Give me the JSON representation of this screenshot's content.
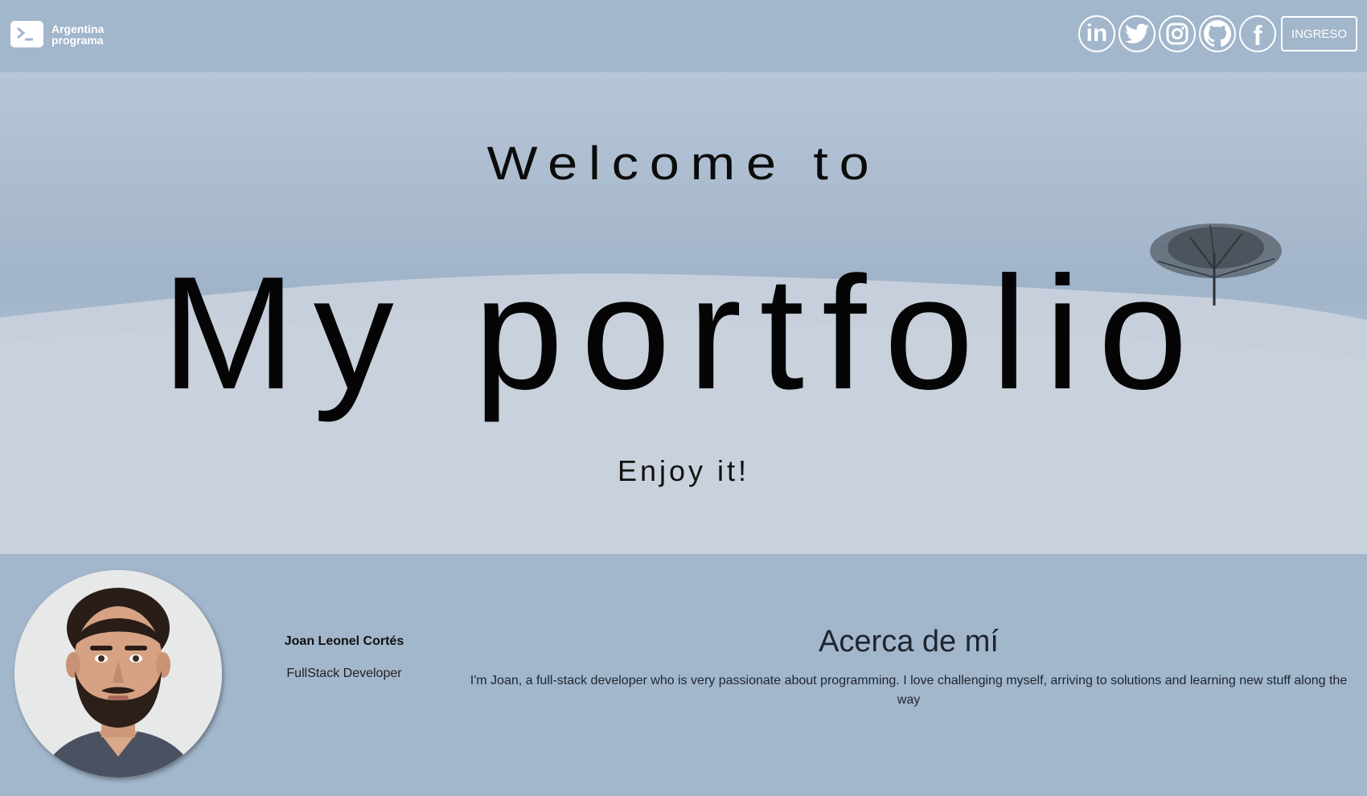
{
  "navbar": {
    "brand": {
      "line1": "Argentina",
      "line2": "programa"
    },
    "socials": [
      {
        "name": "LinkedIn",
        "label": "in"
      },
      {
        "name": "Twitter"
      },
      {
        "name": "Instagram"
      },
      {
        "name": "GitHub"
      },
      {
        "name": "Facebook",
        "label": "f"
      }
    ],
    "login_label": "INGRESO"
  },
  "hero": {
    "welcome": "Welcome to",
    "title": "My portfolio",
    "subtitle": "Enjoy it!"
  },
  "about": {
    "name": "Joan Leonel Cortés",
    "role": "FullStack Developer",
    "heading": "Acerca de mí",
    "text": "I'm Joan, a full-stack developer who is very passionate about programming. I love challenging myself, arriving to solutions and learning new stuff along the way"
  },
  "colors": {
    "background": "#a2b6cc",
    "text_dark": "#1e2530",
    "white": "#ffffff"
  }
}
